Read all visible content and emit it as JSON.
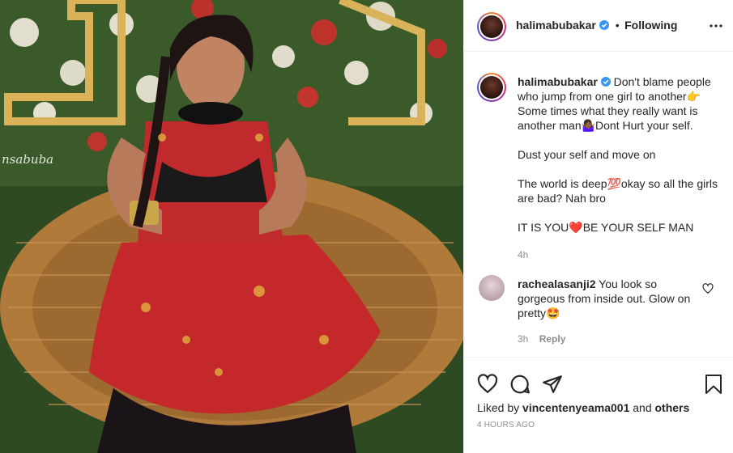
{
  "post": {
    "author": "halimabubakar",
    "follow_state": "Following",
    "dot_separator": "•",
    "watermark_text": "nsabuba"
  },
  "caption": {
    "username": "halimabubakar",
    "line1": "Don't blame people who jump from one girl to another👉",
    "line2": "Some times what they really want is another man🤷🏾‍♀️Dont Hurt your self.",
    "line3": "Dust your self and move on",
    "line4": "The world is deep💯okay so all the girls are bad? Nah bro",
    "line5": "IT IS YOU❤️BE YOUR SELF MAN",
    "age": "4h"
  },
  "comment": {
    "username": "rachealasanji2",
    "text": "You look so gorgeous from inside out. Glow on pretty🤩",
    "age": "3h",
    "reply_label": "Reply"
  },
  "likes": {
    "prefix": "Liked by",
    "user": "vincentenyeama001",
    "joiner": "and",
    "others": "others"
  },
  "timestamp": "4 HOURS AGO",
  "icons": {
    "like": "heart-icon",
    "comment": "comment-icon",
    "share": "share-icon",
    "save": "bookmark-icon",
    "more": "more-icon",
    "verified": "verified-badge-icon"
  },
  "colors": {
    "text": "#262626",
    "muted": "#8e8e8e",
    "verified": "#3897f0",
    "border": "#efefef",
    "heart_emoji": "#ed4956"
  }
}
